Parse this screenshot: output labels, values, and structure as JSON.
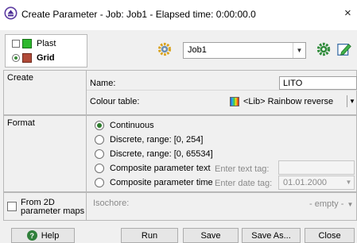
{
  "window": {
    "title": "Create Parameter - Job: Job1 - Elapsed time: 0:00:00.0",
    "close_glyph": "×"
  },
  "objects": {
    "plast_label": "Plast",
    "grid_label": "Grid"
  },
  "job": {
    "selected": "Job1",
    "arrow": "▼"
  },
  "create": {
    "section_label": "Create",
    "name_label": "Name:",
    "name_value": "LITO",
    "colour_label": "Colour table:",
    "colour_value": "<Lib> Rainbow reverse",
    "colour_arrow": "▼"
  },
  "format": {
    "section_label": "Format",
    "options": [
      {
        "label": "Continuous",
        "selected": true
      },
      {
        "label": "Discrete, range: [0, 254]",
        "selected": false
      },
      {
        "label": "Discrete, range: [0, 65534]",
        "selected": false
      },
      {
        "label": "Composite parameter text",
        "selected": false
      },
      {
        "label": "Composite parameter time",
        "selected": false
      }
    ],
    "text_tag_label": "Enter text tag:",
    "date_tag_label": "Enter date tag:",
    "date_value": "01.01.2000",
    "date_arrow": "▼"
  },
  "from2d": {
    "label_line1": "From 2D",
    "label_line2": "parameter maps",
    "isochore_label": "Isochore:",
    "isochore_value": "- empty -",
    "isochore_arrow": "▼"
  },
  "buttons": {
    "help": "Help",
    "help_glyph": "?",
    "run": "Run",
    "save": "Save",
    "save_as": "Save As...",
    "close": "Close"
  },
  "colors": {
    "accent_green": "#2e7d2e",
    "help_icon": "#2f7f3a"
  }
}
